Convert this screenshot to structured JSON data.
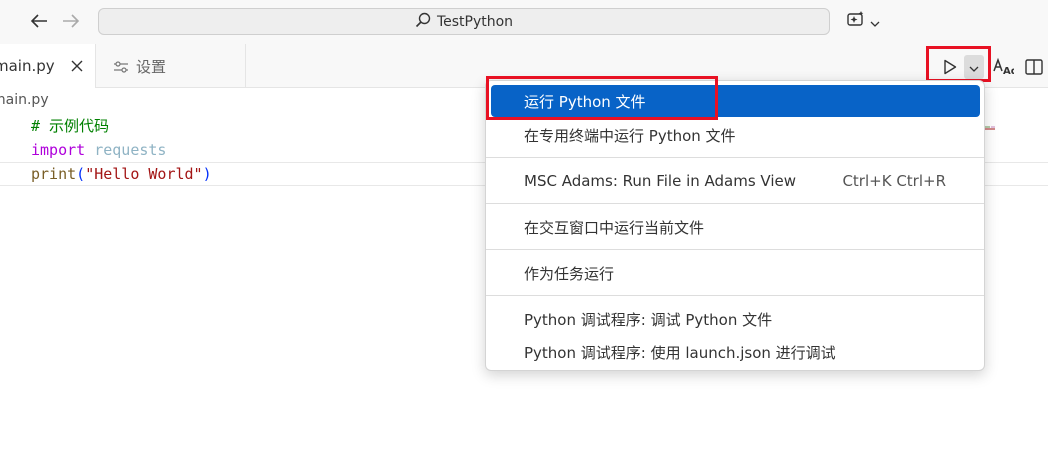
{
  "titlebar": {
    "search_text": "TestPython"
  },
  "tabs": [
    {
      "label": "main.py",
      "active": true
    },
    {
      "label": "设置",
      "active": false
    }
  ],
  "editor": {
    "breadcrumb": "main.py",
    "lines": {
      "comment": "# 示例代码",
      "import_kw": "import",
      "import_module": "requests",
      "print_func": "print",
      "open_paren": "(",
      "string": "\"Hello World\"",
      "close_paren": ")"
    }
  },
  "run_menu": {
    "items": [
      {
        "label": "运行 Python 文件",
        "shortcut": "",
        "selected": true
      },
      {
        "label": "在专用终端中运行 Python 文件",
        "shortcut": ""
      },
      {
        "label": "MSC Adams: Run File in Adams View",
        "shortcut": "Ctrl+K Ctrl+R"
      },
      {
        "label": "在交互窗口中运行当前文件",
        "shortcut": ""
      },
      {
        "label": "作为任务运行",
        "shortcut": ""
      },
      {
        "label": "Python 调试程序: 调试 Python 文件",
        "shortcut": ""
      },
      {
        "label": "Python 调试程序: 使用 launch.json 进行调试",
        "shortcut": ""
      }
    ]
  },
  "colors": {
    "accent": "#0863c7",
    "highlight_border": "#e81123"
  }
}
